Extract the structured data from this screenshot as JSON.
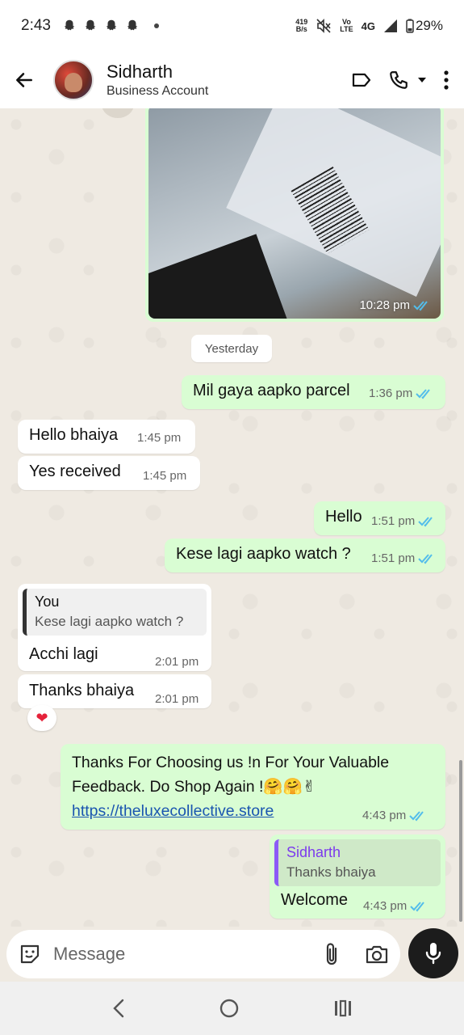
{
  "status_bar": {
    "time": "2:43",
    "net_speed_top": "419",
    "net_speed_bottom": "B/s",
    "volte_top": "Vo",
    "volte_bottom": "LTE",
    "network": "4G",
    "battery": "29%"
  },
  "header": {
    "contact_name": "Sidharth",
    "contact_subtitle": "Business Account"
  },
  "chat": {
    "image_message": {
      "time": "10:28 pm"
    },
    "date_separator": "Yesterday",
    "messages": [
      {
        "direction": "out",
        "text": "Mil gaya aapko parcel",
        "time": "1:36 pm"
      },
      {
        "direction": "in",
        "text": "Hello bhaiya",
        "time": "1:45 pm"
      },
      {
        "direction": "in",
        "text": "Yes received",
        "time": "1:45 pm"
      },
      {
        "direction": "out",
        "text": "Hello",
        "time": "1:51 pm"
      },
      {
        "direction": "out",
        "text": "Kese lagi aapko watch ?",
        "time": "1:51 pm"
      },
      {
        "direction": "in",
        "quote_name": "You",
        "quote_text": "Kese lagi aapko watch ?",
        "text": "Acchi lagi",
        "time": "2:01 pm"
      },
      {
        "direction": "in",
        "text": "Thanks bhaiya",
        "time": "2:01 pm",
        "reaction": "❤"
      },
      {
        "direction": "out",
        "line1": "Thanks For Choosing us !n For Your Valuable",
        "line2": "Feedback. Do Shop Again !🤗🤗✌",
        "link": "https://theluxecollective.store",
        "time": "4:43 pm"
      },
      {
        "direction": "out",
        "quote_name": "Sidharth",
        "quote_text": "Thanks bhaiya",
        "text": "Welcome",
        "time": "4:43 pm"
      }
    ]
  },
  "input": {
    "placeholder": "Message"
  },
  "colors": {
    "outgoing_bubble": "#d9fdd3",
    "incoming_bubble": "#ffffff",
    "chat_background": "#efeae2",
    "read_ticks": "#53bdeb",
    "link": "#1a55b0"
  }
}
